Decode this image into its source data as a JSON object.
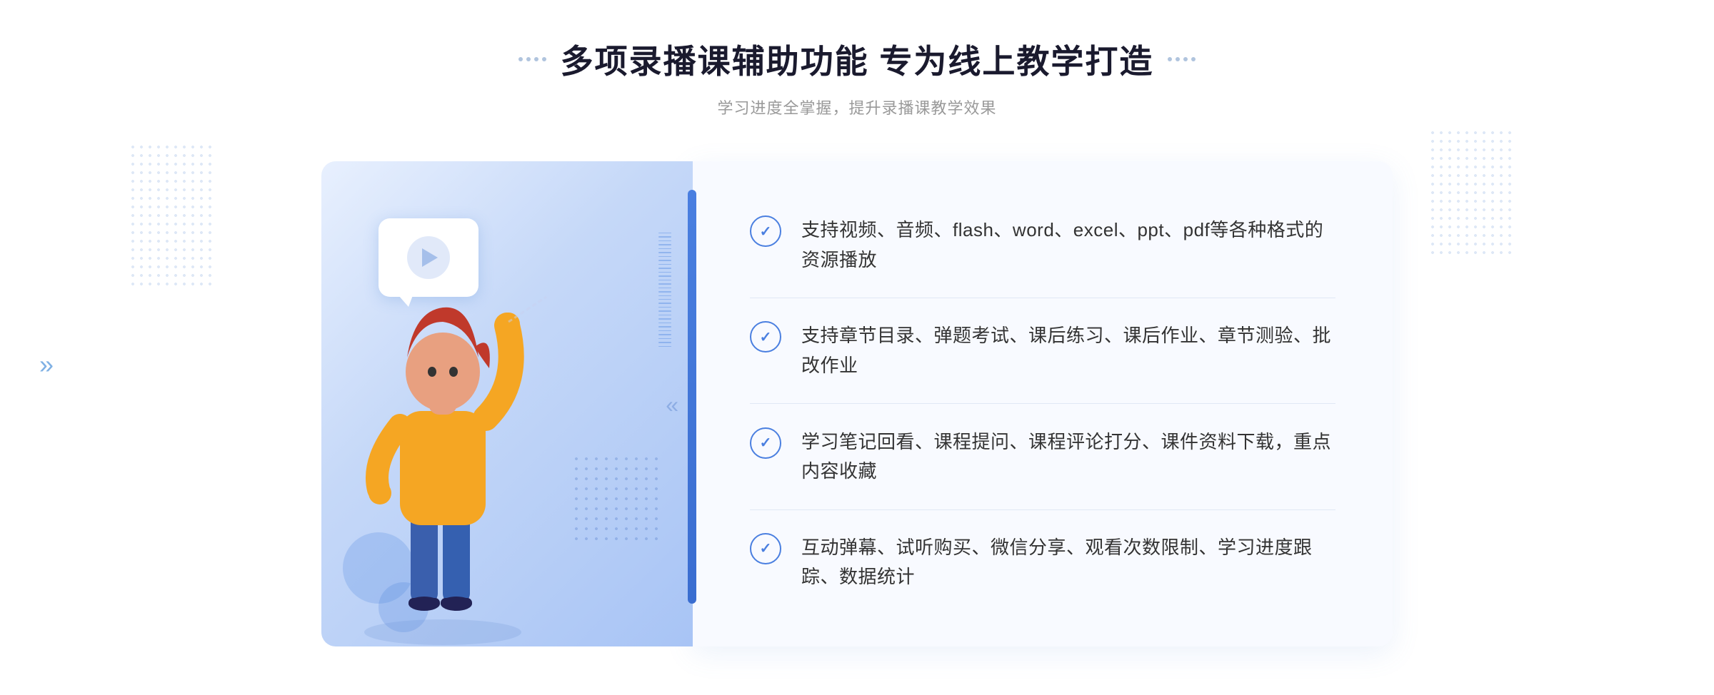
{
  "header": {
    "title": "多项录播课辅助功能 专为线上教学打造",
    "subtitle": "学习进度全掌握，提升录播课教学效果",
    "title_dots": [
      "·",
      "·",
      "·",
      "·"
    ]
  },
  "features": [
    {
      "id": 1,
      "text": "支持视频、音频、flash、word、excel、ppt、pdf等各种格式的资源播放"
    },
    {
      "id": 2,
      "text": "支持章节目录、弹题考试、课后练习、课后作业、章节测验、批改作业"
    },
    {
      "id": 3,
      "text": "学习笔记回看、课程提问、课程评论打分、课件资料下载，重点内容收藏"
    },
    {
      "id": 4,
      "text": "互动弹幕、试听购买、微信分享、观看次数限制、学习进度跟踪、数据统计"
    }
  ],
  "colors": {
    "accent": "#4a7fe0",
    "text_primary": "#1a1a2e",
    "text_secondary": "#666",
    "bg_card": "#f8faff",
    "bg_illustration": "#dce8fa"
  }
}
